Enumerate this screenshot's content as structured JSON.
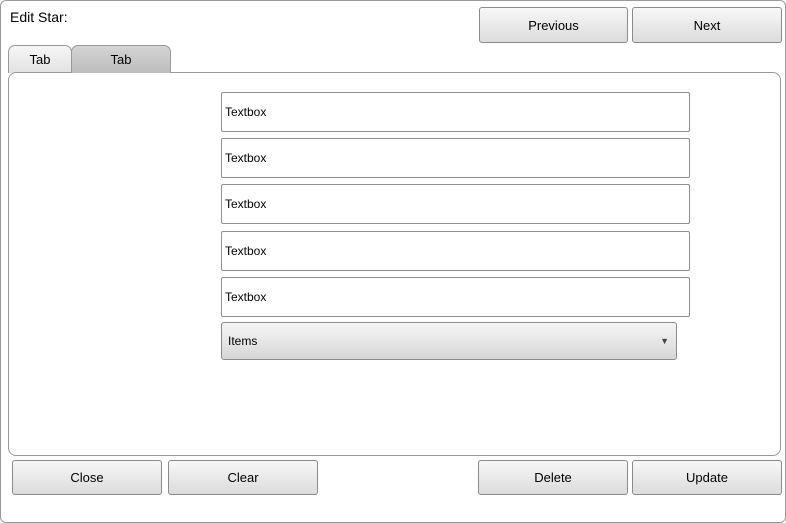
{
  "window": {
    "title": "Edit Star:"
  },
  "nav": {
    "previous_label": "Previous",
    "next_label": "Next"
  },
  "tabs": [
    {
      "label": "Tab",
      "active": false
    },
    {
      "label": "Tab",
      "active": true
    }
  ],
  "form": {
    "textboxes": [
      {
        "value": "Textbox"
      },
      {
        "value": "Textbox"
      },
      {
        "value": "Textbox"
      },
      {
        "value": "Textbox"
      },
      {
        "value": "Textbox"
      }
    ],
    "dropdown": {
      "selected": "Items",
      "arrow_icon": "triangle-down"
    }
  },
  "footer": {
    "close_label": "Close",
    "clear_label": "Clear",
    "delete_label": "Delete",
    "update_label": "Update"
  }
}
